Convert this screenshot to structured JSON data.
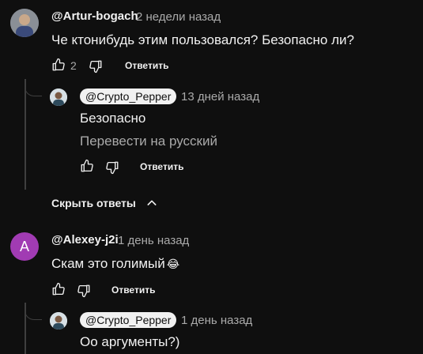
{
  "comments": [
    {
      "author": "@Artur-bogach",
      "time": "2 недели назад",
      "text": "Че ктонибудь этим пользовался? Безопасно ли?",
      "likes": "2",
      "reply_label": "Ответить"
    },
    {
      "author": "@Crypto_Pepper",
      "time": "13 дней назад",
      "text": "Безопасно",
      "translate": "Перевести на русский",
      "reply_label": "Ответить"
    },
    {
      "author": "@Alexey-j2i",
      "avatar_letter": "A",
      "time": "1 день назад",
      "text": "Скам это голимый",
      "emoji": "😂",
      "reply_label": "Ответить"
    },
    {
      "author": "@Crypto_Pepper",
      "time": "1 день назад",
      "text": "Оо аргументы?)"
    }
  ],
  "hide_replies_label": "Скрыть ответы",
  "colors": {
    "background": "#0f0f0f",
    "avatar_purple": "#a13bb3",
    "secondary_text": "#aaaaaa"
  }
}
